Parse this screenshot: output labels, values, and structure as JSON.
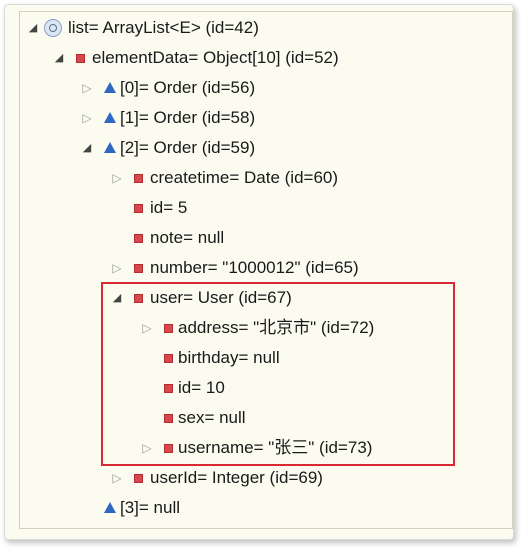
{
  "tree": {
    "rows": [
      {
        "id": "list",
        "label": "list= ArrayList<E>  (id=42)",
        "depth": 0,
        "arrow": "expanded",
        "icon": "field-object-icon"
      },
      {
        "id": "elementData",
        "label": "elementData= Object[10]  (id=52)",
        "depth": 1,
        "arrow": "expanded",
        "icon": "private-field-icon"
      },
      {
        "id": "item0",
        "label": "[0]= Order  (id=56)",
        "depth": 2,
        "arrow": "collapsed",
        "icon": "array-element-icon"
      },
      {
        "id": "item1",
        "label": "[1]= Order  (id=58)",
        "depth": 2,
        "arrow": "collapsed",
        "icon": "array-element-icon"
      },
      {
        "id": "item2",
        "label": "[2]= Order  (id=59)",
        "depth": 2,
        "arrow": "expanded",
        "icon": "array-element-icon"
      },
      {
        "id": "createtime",
        "label": "createtime= Date  (id=60)",
        "depth": 3,
        "arrow": "collapsed",
        "icon": "private-field-icon"
      },
      {
        "id": "id5",
        "label": "id= 5",
        "depth": 3,
        "arrow": "none",
        "icon": "private-field-icon"
      },
      {
        "id": "note",
        "label": "note= null",
        "depth": 3,
        "arrow": "none",
        "icon": "private-field-icon"
      },
      {
        "id": "number",
        "label": "number= \"1000012\" (id=65)",
        "depth": 3,
        "arrow": "collapsed",
        "icon": "private-field-icon"
      },
      {
        "id": "user",
        "label": "user= User  (id=67)",
        "depth": 3,
        "arrow": "expanded",
        "icon": "private-field-icon"
      },
      {
        "id": "address",
        "label": "address= \"北京市\" (id=72)",
        "depth": 4,
        "arrow": "collapsed",
        "icon": "private-field-icon"
      },
      {
        "id": "birthday",
        "label": "birthday= null",
        "depth": 4,
        "arrow": "none",
        "icon": "private-field-icon"
      },
      {
        "id": "id10",
        "label": "id= 10",
        "depth": 4,
        "arrow": "none",
        "icon": "private-field-icon"
      },
      {
        "id": "sex",
        "label": "sex= null",
        "depth": 4,
        "arrow": "none",
        "icon": "private-field-icon"
      },
      {
        "id": "username",
        "label": "username= \"张三\" (id=73)",
        "depth": 4,
        "arrow": "collapsed",
        "icon": "private-field-icon"
      },
      {
        "id": "userId",
        "label": "userId= Integer  (id=69)",
        "depth": 3,
        "arrow": "collapsed",
        "icon": "private-field-icon"
      },
      {
        "id": "item3",
        "label": "[3]= null",
        "depth": 2,
        "arrow": "none",
        "icon": "array-element-icon"
      }
    ]
  },
  "colors": {
    "highlight_box": "#d72a33",
    "field_icon": "#d8474b",
    "array_icon": "#2f68c4",
    "background": "#fbfbf0"
  }
}
